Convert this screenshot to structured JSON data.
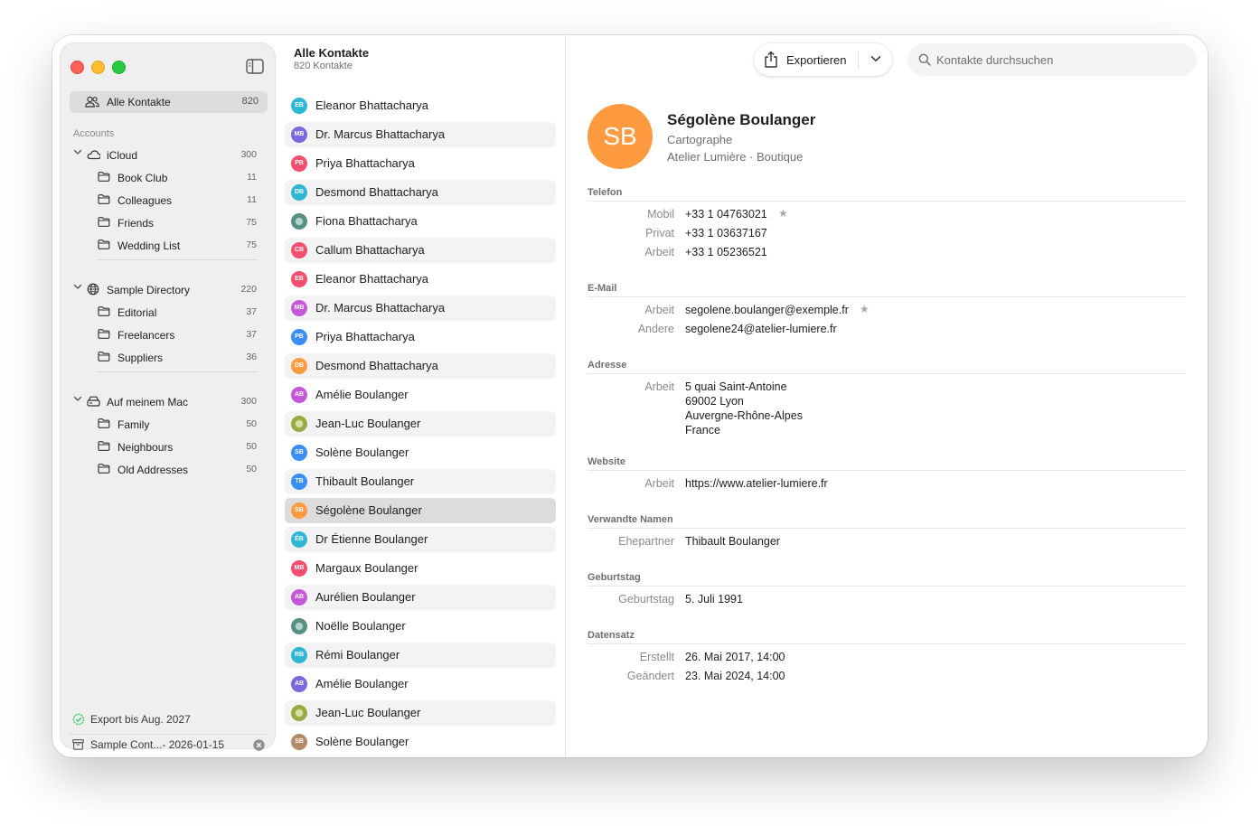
{
  "sidebar": {
    "all_contacts": {
      "label": "Alle Kontakte",
      "count": "820"
    },
    "accounts_label": "Accounts",
    "groups": [
      {
        "label": "iCloud",
        "count": "300",
        "icon": "cloud-icon",
        "items": [
          {
            "label": "Book Club",
            "count": "11"
          },
          {
            "label": "Colleagues",
            "count": "11"
          },
          {
            "label": "Friends",
            "count": "75"
          },
          {
            "label": "Wedding List",
            "count": "75"
          }
        ]
      },
      {
        "label": "Sample Directory",
        "count": "220",
        "icon": "globe-icon",
        "items": [
          {
            "label": "Editorial",
            "count": "37"
          },
          {
            "label": "Freelancers",
            "count": "37"
          },
          {
            "label": "Suppliers",
            "count": "36"
          }
        ]
      },
      {
        "label": "Auf meinem Mac",
        "count": "300",
        "icon": "drive-icon",
        "items": [
          {
            "label": "Family",
            "count": "50"
          },
          {
            "label": "Neighbours",
            "count": "50"
          },
          {
            "label": "Old Addresses",
            "count": "50"
          }
        ]
      }
    ],
    "footer": {
      "export_status": "Export bis Aug. 2027",
      "archive": "Sample Cont...- 2026-01-15"
    }
  },
  "list": {
    "title": "Alle Kontakte",
    "subtitle": "820 Kontakte",
    "contacts": [
      {
        "name": "Eleanor Bhattacharya",
        "initials": "EB",
        "color": "#2fb5d6"
      },
      {
        "name": "Dr. Marcus Bhattacharya",
        "initials": "MB",
        "color": "#7b68de"
      },
      {
        "name": "Priya Bhattacharya",
        "initials": "PB",
        "color": "#f0506e"
      },
      {
        "name": "Desmond Bhattacharya",
        "initials": "DB",
        "color": "#2fb5d6"
      },
      {
        "name": "Fiona Bhattacharya",
        "initials": "",
        "color": "#5f9b8e"
      },
      {
        "name": "Callum Bhattacharya",
        "initials": "CB",
        "color": "#f0506e"
      },
      {
        "name": "Eleanor Bhattacharya",
        "initials": "EB",
        "color": "#f0506e"
      },
      {
        "name": "Dr. Marcus Bhattacharya",
        "initials": "MB",
        "color": "#c558d8"
      },
      {
        "name": "Priya Bhattacharya",
        "initials": "PB",
        "color": "#3a8ef6"
      },
      {
        "name": "Desmond Bhattacharya",
        "initials": "DB",
        "color": "#fe9a3f"
      },
      {
        "name": "Amélie Boulanger",
        "initials": "AB",
        "color": "#c558d8"
      },
      {
        "name": "Jean-Luc Boulanger",
        "initials": "",
        "color": "#a8b84a"
      },
      {
        "name": "Solène Boulanger",
        "initials": "SB",
        "color": "#3a8ef6"
      },
      {
        "name": "Thibault Boulanger",
        "initials": "TB",
        "color": "#3a8ef6"
      },
      {
        "name": "Ségolène Boulanger",
        "initials": "SB",
        "color": "#fe9a3f"
      },
      {
        "name": "Dr Étienne Boulanger",
        "initials": "ÉB",
        "color": "#2fb5d6"
      },
      {
        "name": "Margaux Boulanger",
        "initials": "MB",
        "color": "#f0506e"
      },
      {
        "name": "Aurélien Boulanger",
        "initials": "AB",
        "color": "#c558d8"
      },
      {
        "name": "Noëlle Boulanger",
        "initials": "",
        "color": "#5f9b8e"
      },
      {
        "name": "Rémi Boulanger",
        "initials": "RB",
        "color": "#2fb5d6"
      },
      {
        "name": "Amélie Boulanger",
        "initials": "AB",
        "color": "#7b68de"
      },
      {
        "name": "Jean-Luc Boulanger",
        "initials": "",
        "color": "#a8b84a"
      },
      {
        "name": "Solène Boulanger",
        "initials": "SB",
        "color": "#b58a6a"
      }
    ],
    "selected_index": 14
  },
  "toolbar": {
    "export_label": "Exportieren",
    "search_placeholder": "Kontakte durchsuchen"
  },
  "detail": {
    "initials": "SB",
    "avatar_color": "#fe9a3f",
    "name": "Ségolène Boulanger",
    "job": "Cartographe",
    "org": "Atelier Lumière · Boutique",
    "sections": [
      {
        "title": "Telefon",
        "fields": [
          {
            "label": "Mobil",
            "lines": [
              "+33 1 04763021"
            ],
            "star": true
          },
          {
            "label": "Privat",
            "lines": [
              "+33 1 03637167"
            ]
          },
          {
            "label": "Arbeit",
            "lines": [
              "+33 1 05236521"
            ]
          }
        ]
      },
      {
        "title": "E-Mail",
        "fields": [
          {
            "label": "Arbeit",
            "lines": [
              "segolene.boulanger@exemple.fr"
            ],
            "star": true
          },
          {
            "label": "Andere",
            "lines": [
              "segolene24@atelier-lumiere.fr"
            ]
          }
        ]
      },
      {
        "title": "Adresse",
        "fields": [
          {
            "label": "Arbeit",
            "lines": [
              "5 quai Saint-Antoine",
              "69002 Lyon",
              "Auvergne-Rhône-Alpes",
              "France"
            ]
          }
        ]
      },
      {
        "title": "Website",
        "fields": [
          {
            "label": "Arbeit",
            "lines": [
              "https://www.atelier-lumiere.fr"
            ]
          }
        ]
      },
      {
        "title": "Verwandte Namen",
        "fields": [
          {
            "label": "Ehepartner",
            "lines": [
              "Thibault Boulanger"
            ]
          }
        ]
      },
      {
        "title": "Geburtstag",
        "fields": [
          {
            "label": "Geburtstag",
            "lines": [
              "5. Juli 1991"
            ]
          }
        ]
      },
      {
        "title": "Datensatz",
        "fields": [
          {
            "label": "Erstellt",
            "lines": [
              "26. Mai 2017, 14:00"
            ]
          },
          {
            "label": "Geändert",
            "lines": [
              "23. Mai 2024, 14:00"
            ]
          }
        ]
      }
    ]
  }
}
